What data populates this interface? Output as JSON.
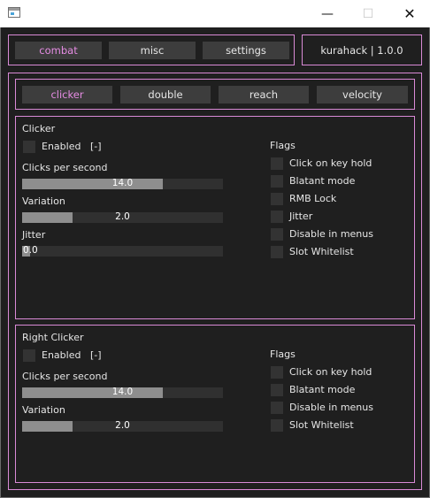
{
  "window": {
    "minimize_glyph": "—",
    "maximize_glyph": "☐",
    "close_glyph": "✕"
  },
  "nav": {
    "tabs": [
      {
        "label": "combat",
        "active": true
      },
      {
        "label": "misc",
        "active": false
      },
      {
        "label": "settings",
        "active": false
      }
    ],
    "brand": "kurahack | 1.0.0"
  },
  "subnav": {
    "tabs": [
      {
        "label": "clicker",
        "active": true
      },
      {
        "label": "double",
        "active": false
      },
      {
        "label": "reach",
        "active": false
      },
      {
        "label": "velocity",
        "active": false
      }
    ]
  },
  "clicker": {
    "title": "Clicker",
    "enabled_label": "Enabled",
    "keybind": "[-]",
    "cps_label": "Clicks per second",
    "cps_value": "14.0",
    "cps_fraction": 0.7,
    "variation_label": "Variation",
    "variation_value": "2.0",
    "variation_fraction": 0.25,
    "jitter_label": "Jitter",
    "jitter_value": "0.0",
    "jitter_fraction": 0.04,
    "flags_title": "Flags",
    "flags": [
      "Click on key hold",
      "Blatant mode",
      "RMB Lock",
      "Jitter",
      "Disable in menus",
      "Slot Whitelist"
    ]
  },
  "right_clicker": {
    "title": "Right Clicker",
    "enabled_label": "Enabled",
    "keybind": "[-]",
    "cps_label": "Clicks per second",
    "cps_value": "14.0",
    "cps_fraction": 0.7,
    "variation_label": "Variation",
    "variation_value": "2.0",
    "variation_fraction": 0.25,
    "flags_title": "Flags",
    "flags": [
      "Click on key hold",
      "Blatant mode",
      "Disable in menus",
      "Slot Whitelist"
    ]
  },
  "colors": {
    "accent": "#e58ce3",
    "frame": "#d98ad6",
    "background": "#1f1f1f",
    "button": "#3d3d3d"
  }
}
